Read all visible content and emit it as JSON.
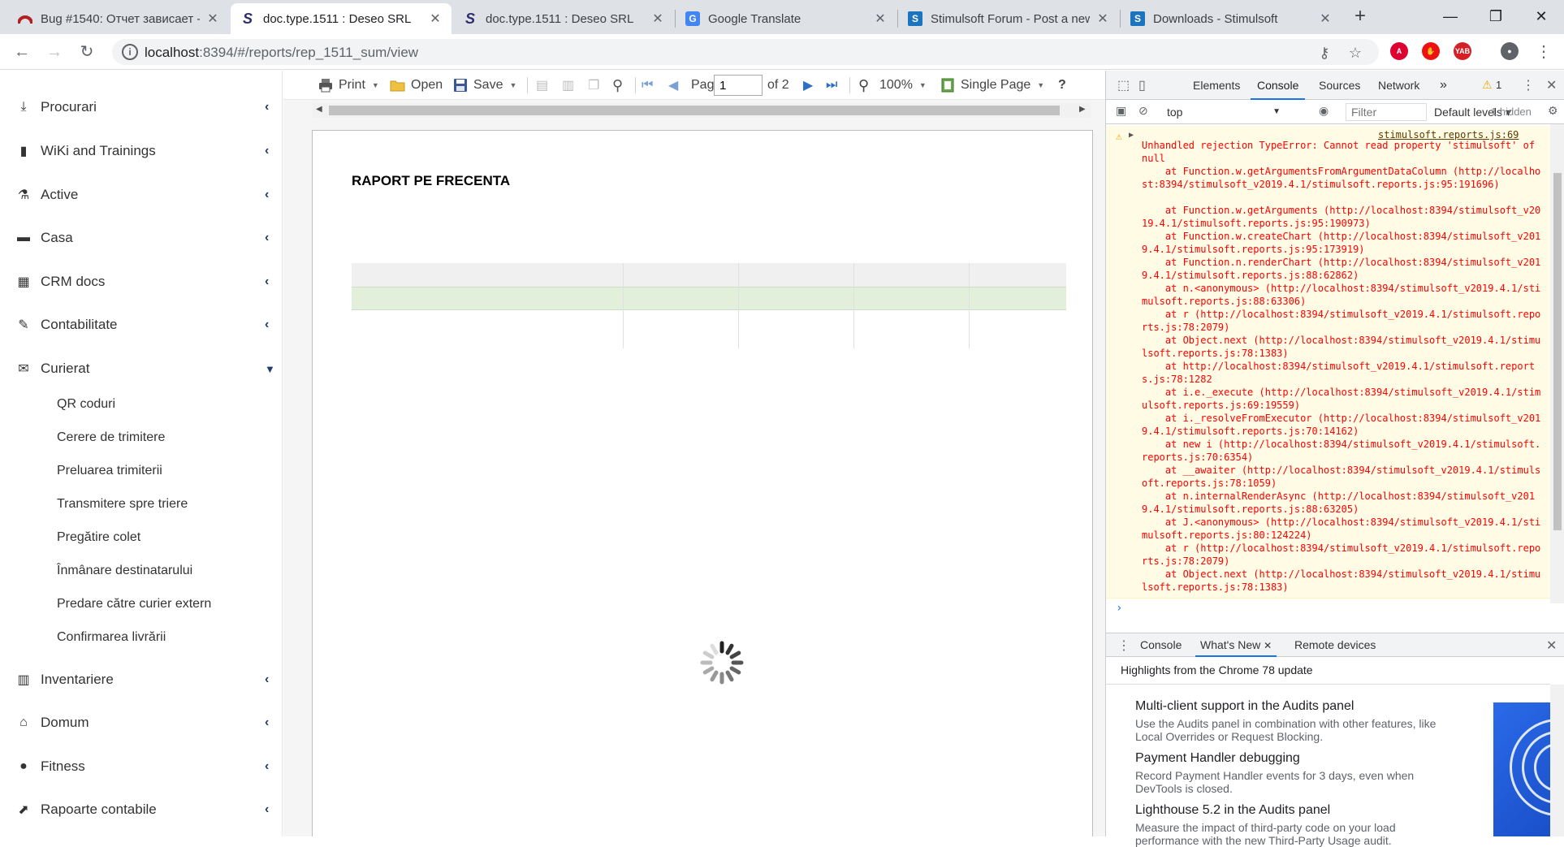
{
  "browser": {
    "tabs": [
      {
        "title": "Bug #1540: Отчет зависает -",
        "icon": "redmine-icon",
        "active": false
      },
      {
        "title": "doc.type.1511 : Deseo SRL",
        "icon": "stimulsoft-s-icon",
        "active": true
      },
      {
        "title": "doc.type.1511 : Deseo SRL",
        "icon": "stimulsoft-s-icon",
        "active": false
      },
      {
        "title": "Google Translate",
        "icon": "google-translate-icon",
        "active": false
      },
      {
        "title": "Stimulsoft Forum - Post a new",
        "icon": "stimulsoft-forum-icon",
        "active": false
      },
      {
        "title": "Downloads - Stimulsoft",
        "icon": "stimulsoft-forum-icon",
        "active": false
      }
    ],
    "tab_close": "✕",
    "new_tab": "+",
    "url_host": "localhost",
    "url_path": ":8394/#/reports/rep_1511_sum/view",
    "ext_yab": "YAB"
  },
  "sidebar": {
    "items": [
      {
        "label": "Procurari",
        "icon": "download-icon",
        "glyph": "⤓"
      },
      {
        "label": "WiKi and Trainings",
        "icon": "book-icon",
        "glyph": "▮"
      },
      {
        "label": "Active",
        "icon": "flask-icon",
        "glyph": "⚗"
      },
      {
        "label": "Casa",
        "icon": "briefcase-icon",
        "glyph": "▬"
      },
      {
        "label": "CRM docs",
        "icon": "table-icon",
        "glyph": "▦"
      },
      {
        "label": "Contabilitate",
        "icon": "pin-icon",
        "glyph": "✎"
      },
      {
        "label": "Curierat",
        "icon": "envelope-icon",
        "glyph": "✉"
      }
    ],
    "sub_items": [
      "QR coduri",
      "Cerere de trimitere",
      "Preluarea trimiterii",
      "Transmitere spre triere",
      "Pregătire colet",
      "Înmânare destinatarului",
      "Predare către curier extern",
      "Confirmarea livrării"
    ],
    "items_bottom": [
      {
        "label": "Inventariere",
        "icon": "barcode-icon",
        "glyph": "▥"
      },
      {
        "label": "Domum",
        "icon": "home-icon",
        "glyph": "⌂"
      },
      {
        "label": "Fitness",
        "icon": "apple-icon",
        "glyph": "●"
      },
      {
        "label": "Rapoarte contabile",
        "icon": "chart-icon",
        "glyph": "⬈"
      }
    ]
  },
  "viewer": {
    "print": "Print",
    "open": "Open",
    "save": "Save",
    "page_label": "Page",
    "page_value": "1",
    "page_of": "of 2",
    "zoom": "100%",
    "view_mode": "Single Page",
    "help": "?",
    "report_title": "RAPORT PE FRECENTA",
    "colors": {
      "header_row": "#f0f0f0",
      "band_row": "#e2efda"
    }
  },
  "devtools": {
    "tabs": [
      "Elements",
      "Console",
      "Sources",
      "Network"
    ],
    "more": "»",
    "warn_count": "1",
    "context": "top",
    "filter_placeholder": "Filter",
    "levels": "Default levels",
    "hidden": "1 hidden",
    "error_source": "stimulsoft.reports.js:69",
    "error_lines": [
      "Unhandled rejection TypeError: Cannot read property 'stimulsoft' of null",
      "    at Function.w.getArgumentsFromArgumentDataColumn (http://localhost:8394/stimulsoft_v2019.4.1/stimulsoft.reports.js:95:191696)",
      "    at Function.w.getArguments (http://localhost:8394/stimulsoft_v2019.4.1/stimulsoft.reports.js:95:190973)",
      "    at Function.w.createChart (http://localhost:8394/stimulsoft_v2019.4.1/stimulsoft.reports.js:95:173919)",
      "    at Function.n.renderChart (http://localhost:8394/stimulsoft_v2019.4.1/stimulsoft.reports.js:88:62862)",
      "    at n.<anonymous> (http://localhost:8394/stimulsoft_v2019.4.1/stimulsoft.reports.js:88:63306)",
      "    at r (http://localhost:8394/stimulsoft_v2019.4.1/stimulsoft.reports.js:78:2079)",
      "    at Object.next (http://localhost:8394/stimulsoft_v2019.4.1/stimulsoft.reports.js:78:1383)",
      "    at http://localhost:8394/stimulsoft_v2019.4.1/stimulsoft.reports.js:78:1282",
      "    at i.e._execute (http://localhost:8394/stimulsoft_v2019.4.1/stimulsoft.reports.js:69:19559)",
      "    at i._resolveFromExecutor (http://localhost:8394/stimulsoft_v2019.4.1/stimulsoft.reports.js:70:14162)",
      "    at new i (http://localhost:8394/stimulsoft_v2019.4.1/stimulsoft.reports.js:70:6354)",
      "    at __awaiter (http://localhost:8394/stimulsoft_v2019.4.1/stimulsoft.reports.js:78:1059)",
      "    at n.internalRenderAsync (http://localhost:8394/stimulsoft_v2019.4.1/stimulsoft.reports.js:88:63205)",
      "    at J.<anonymous> (http://localhost:8394/stimulsoft_v2019.4.1/stimulsoft.reports.js:80:124224)",
      "    at r (http://localhost:8394/stimulsoft_v2019.4.1/stimulsoft.reports.js:78:2079)",
      "    at Object.next (http://localhost:8394/stimulsoft_v2019.4.1/stimulsoft.reports.js:78:1383)"
    ],
    "prompt": "›",
    "drawer_tabs": [
      "Console",
      "What's New",
      "Remote devices"
    ],
    "whats_new_header": "Highlights from the Chrome 78 update",
    "features": [
      {
        "title": "Multi-client support in the Audits panel",
        "desc": "Use the Audits panel in combination with other features, like Local Overrides or Request Blocking."
      },
      {
        "title": "Payment Handler debugging",
        "desc": "Record Payment Handler events for 3 days, even when DevTools is closed."
      },
      {
        "title": "Lighthouse 5.2 in the Audits panel",
        "desc": "Measure the impact of third-party code on your load performance with the new Third-Party Usage audit."
      }
    ]
  }
}
